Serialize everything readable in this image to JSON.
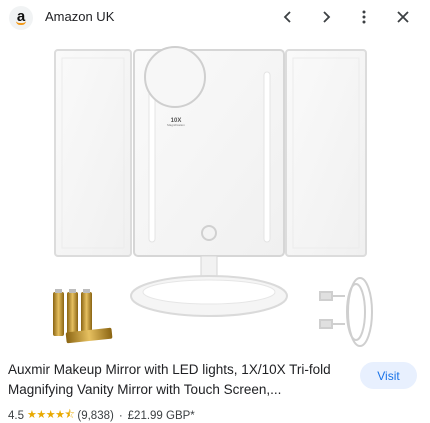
{
  "header": {
    "favicon_letter": "a",
    "site_name": "Amazon UK",
    "icons": [
      "chevron-left-icon",
      "chevron-right-icon",
      "more-vert-icon",
      "close-icon"
    ]
  },
  "image": {
    "magnifier_label_line1": "10X",
    "magnifier_label_line2": "Magnification",
    "accent_color": "#c99a2e"
  },
  "product": {
    "title": "Auxmir Makeup Mirror with LED lights, 1X/10X Tri-fold Magnifying Vanity Mirror with Touch Screen,...",
    "rating": "4.5",
    "stars": "★★★★⯪",
    "review_count": "(9,838)",
    "separator": "·",
    "price": "£21.99 GBP*"
  },
  "actions": {
    "visit_label": "Visit"
  },
  "colors": {
    "link": "#1a73e8",
    "visit_bg": "#e8f0fe",
    "star": "#e8a900"
  }
}
